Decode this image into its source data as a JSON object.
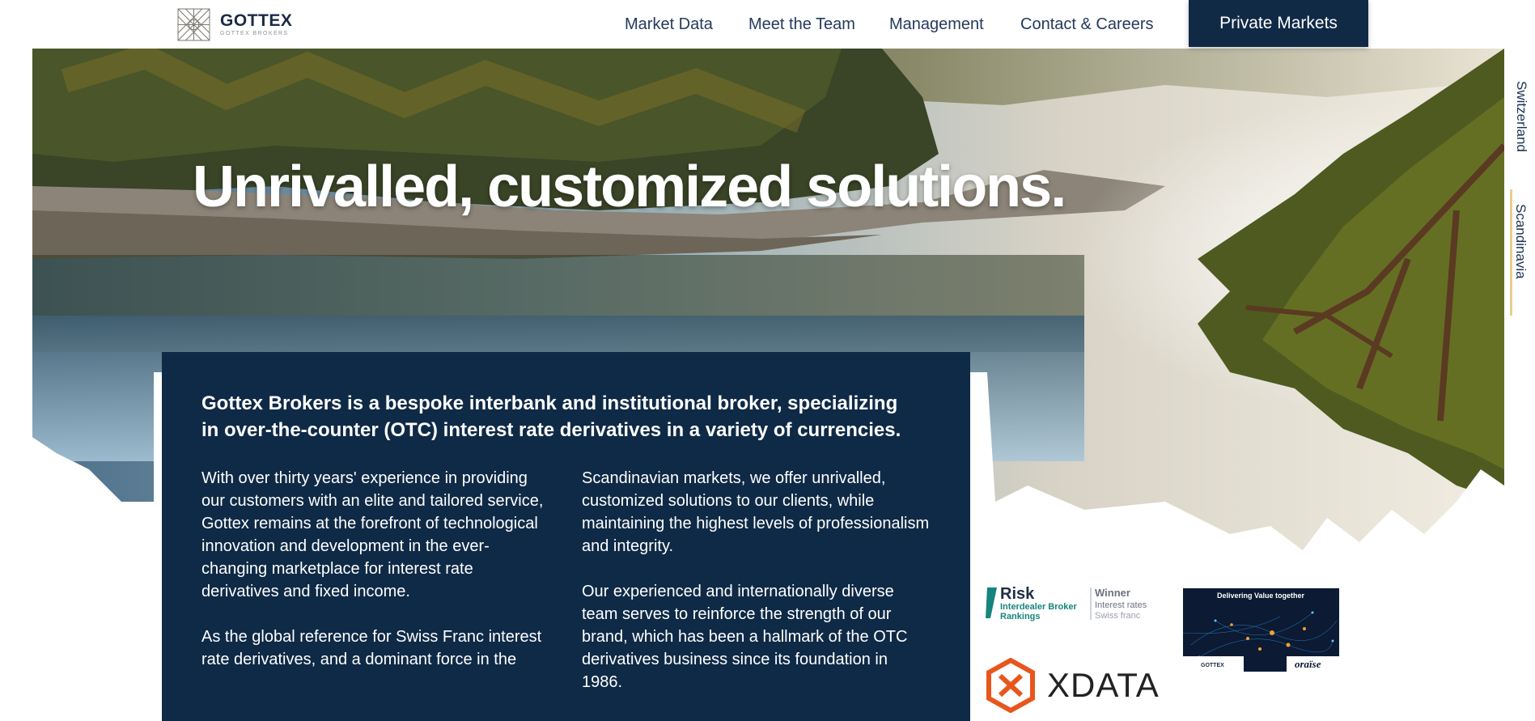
{
  "header": {
    "brand_name": "GOTTEX",
    "brand_sub": "GOTTEX BROKERS",
    "nav": [
      "Market Data",
      "Meet the Team",
      "Management",
      "Contact & Careers"
    ],
    "cta": "Private Markets"
  },
  "hero": {
    "title": "Unrivalled, customized solutions."
  },
  "side_tabs": {
    "items": [
      "Switzerland",
      "Scandinavia"
    ],
    "active": "Scandinavia"
  },
  "about": {
    "intro": "Gottex Brokers is a bespoke interbank and institutional broker, specializing in over-the-counter (OTC) interest rate derivatives in a variety of currencies.",
    "col1": [
      "With over thirty years' experience in providing our customers with an elite and tailored service, Gottex remains at the forefront of technological innovation and development in the ever-changing marketplace for interest rate derivatives and fixed income.",
      "As the global reference for Swiss Franc interest rate derivatives, and a dominant force in the"
    ],
    "col2": [
      "Scandinavian markets, we offer unrivalled, customized solutions to our clients, while maintaining the highest levels of professionalism and integrity.",
      "Our experienced and internationally diverse team serves to reinforce the strength of our brand, which has been a hallmark of the OTC derivatives business since its foundation in 1986."
    ]
  },
  "awards": {
    "risk_title": "Risk",
    "risk_sub1": "Interdealer Broker",
    "risk_sub2": "Rankings",
    "risk_winner": "Winner",
    "risk_line1": "Interest rates",
    "risk_line2": "Swiss franc",
    "oraise_heading": "Delivering Value together",
    "oraise_brand": "oraïse",
    "oraise_left": "GOTTEX",
    "xdata": "XDATA"
  },
  "colors": {
    "navy": "#0f2a46",
    "accent_gold": "#e6cf8d",
    "xdata_orange": "#e8561c"
  }
}
